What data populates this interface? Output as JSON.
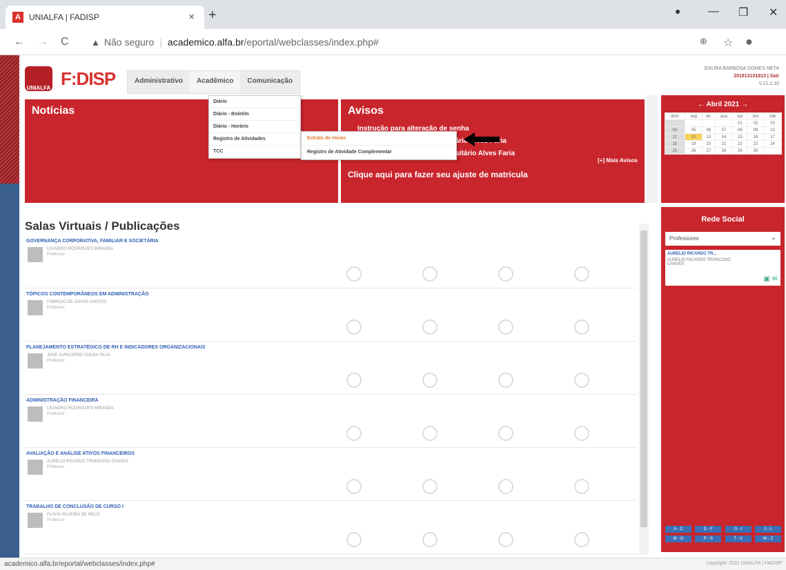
{
  "browser": {
    "tab_title": "UNIALFA | FADISP",
    "tab_close": "×",
    "new_tab": "+",
    "security_label": "Não seguro",
    "url_host": "academico.alfa.br",
    "url_path": "/eportal/webclasses/index.php#",
    "window_min": "—",
    "window_restore": "❐",
    "window_close": "✕"
  },
  "header": {
    "brand": "F:DISP",
    "seal_text": "UNIALFA",
    "menu": [
      "Administrativo",
      "Acadêmico",
      "Comunicação"
    ],
    "user_name": "IZAURA BARBOSA GOMES NETA",
    "user_id": "201813101813 | Sair",
    "version": "V.21.2.10"
  },
  "noticias": {
    "title": "Notícias"
  },
  "dropdown": {
    "items": [
      "Diário",
      "Diário - Boletim",
      "Diário - Horário",
      "Registro de Atividades",
      "TCC"
    ],
    "submenu": [
      "Extrato de Horas",
      "Registro de Atividade Complementar"
    ]
  },
  "avisos": {
    "title": "Avisos",
    "items": [
      "Instrução para alteração de senha",
      "Resultado — Centro Universitário Alves Faria",
      "Comunicado — Centro Universitário Alves Faria"
    ],
    "mais": "[+] Mais Avisos",
    "ajuste": "Clique aqui para fazer seu ajuste de matricula"
  },
  "salas": {
    "title": "Salas Virtuais / Publicações",
    "courses": [
      {
        "title": "GOVERNANÇA CORPORATIVA, FAMILIAR E SOCIETÁRIA",
        "prof": "LEANDRO RODRIGUES MIRANDA",
        "role": "Professor"
      },
      {
        "title": "TÓPICOS CONTEMPORÂNEOS EM ADMINISTRAÇÃO",
        "prof": "FABRICIO DE SOUSA SANTOS",
        "role": "Professor"
      },
      {
        "title": "PLANEJAMENTO ESTRATÉGICO DE RH E INDICADORES ORGANIZACIONAIS",
        "prof": "JOSE AURICIERIO SOUSA SILVA",
        "role": "Professor"
      },
      {
        "title": "ADMINISTRAÇÃO FINANCEIRA",
        "prof": "LEANDRO RODRIGUES MIRANDA",
        "role": "Professor"
      },
      {
        "title": "AVALIAÇÃO E ANÁLISE ATIVOS FINANCEIROS",
        "prof": "AURELIO RICARDO TRONCOSO CHAVES",
        "role": "Professor"
      },
      {
        "title": "TRABALHO DE CONCLUSÃO DE CURSO I",
        "prof": "FLAVIA SILVEIRA DE MELO",
        "role": "Professor"
      }
    ]
  },
  "calendar": {
    "month": "← Abril 2021 →",
    "weekdays": [
      "dom",
      "seg",
      "ter",
      "qua",
      "qui",
      "sex",
      "sáb"
    ],
    "weeks": [
      [
        "",
        "",
        "",
        "",
        "01",
        "02",
        "03"
      ],
      [
        "04",
        "05",
        "06",
        "07",
        "08",
        "09",
        "10"
      ],
      [
        "11",
        "12",
        "13",
        "14",
        "15",
        "16",
        "17"
      ],
      [
        "18",
        "19",
        "20",
        "21",
        "22",
        "23",
        "24"
      ],
      [
        "25",
        "26",
        "27",
        "28",
        "29",
        "30",
        ""
      ]
    ],
    "today": "12"
  },
  "rede": {
    "title": "Rede Social",
    "select_value": "Professores",
    "card_name": "AURELIO RICARDO TR...",
    "card_photo": "AURELIO RICARDO TRONCOSO CHAVES",
    "alpha": [
      "A - C",
      "D - F",
      "G - I",
      "J - L",
      "M - O",
      "P - S",
      "T - V",
      "W - Z"
    ]
  },
  "status": {
    "url": "academico.alfa.br/eportal/webclasses/index.php#",
    "copyright": "copyright: 2021 UNIALFA | FADISP"
  }
}
